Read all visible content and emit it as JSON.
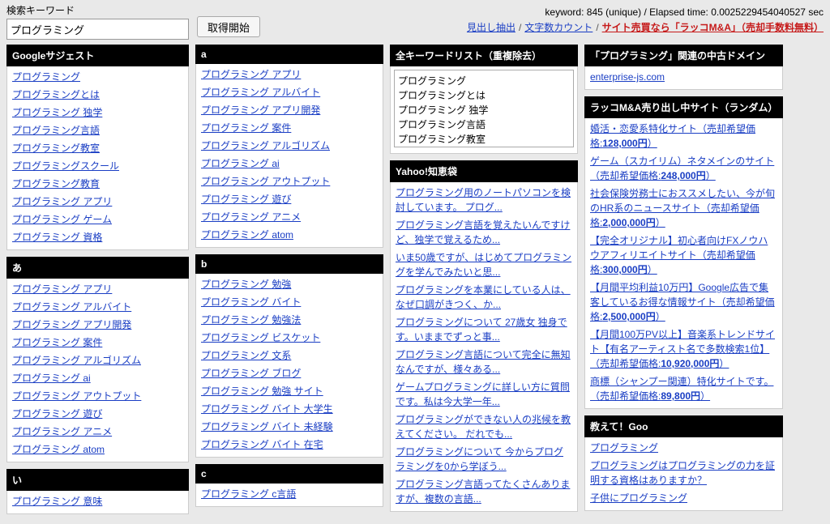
{
  "search": {
    "label": "検索キーワード",
    "value": "プログラミング",
    "button": "取得開始"
  },
  "meta": {
    "stats": "keyword: 845 (unique) / Elapsed time: 0.0025229454040527 sec",
    "nav": {
      "a": "見出し抽出",
      "b": "文字数カウント",
      "c": "サイト売買なら「ラッコM&A」（売却手数料無料）"
    }
  },
  "col1": {
    "google_suggest": {
      "title": "Googleサジェスト",
      "items": [
        "プログラミング",
        "プログラミングとは",
        "プログラミング 独学",
        "プログラミング言語",
        "プログラミング教室",
        "プログラミングスクール",
        "プログラミング教育",
        "プログラミング アプリ",
        "プログラミング ゲーム",
        "プログラミング 資格"
      ]
    },
    "a": {
      "title": "あ",
      "items": [
        "プログラミング アプリ",
        "プログラミング アルバイト",
        "プログラミング アプリ開発",
        "プログラミング 案件",
        "プログラミング アルゴリズム",
        "プログラミング ai",
        "プログラミング アウトプット",
        "プログラミング 遊び",
        "プログラミング アニメ",
        "プログラミング atom"
      ]
    },
    "i": {
      "title": "い",
      "items": [
        "プログラミング 意味"
      ]
    }
  },
  "col2": {
    "a": {
      "title": "a",
      "items": [
        "プログラミング アプリ",
        "プログラミング アルバイト",
        "プログラミング アプリ開発",
        "プログラミング 案件",
        "プログラミング アルゴリズム",
        "プログラミング ai",
        "プログラミング アウトプット",
        "プログラミング 遊び",
        "プログラミング アニメ",
        "プログラミング atom"
      ]
    },
    "b": {
      "title": "b",
      "items": [
        "プログラミング 勉強",
        "プログラミング バイト",
        "プログラミング 勉強法",
        "プログラミング ビスケット",
        "プログラミング 文系",
        "プログラミング ブログ",
        "プログラミング 勉強 サイト",
        "プログラミング バイト 大学生",
        "プログラミング バイト 未経験",
        "プログラミング バイト 在宅"
      ]
    },
    "c": {
      "title": "c",
      "items": [
        "プログラミング c言語"
      ]
    }
  },
  "col3": {
    "all_kw": {
      "title": "全キーワードリスト（重複除去）",
      "text": "プログラミング\nプログラミングとは\nプログラミング 独学\nプログラミング言語\nプログラミング教室"
    },
    "yahoo": {
      "title": "Yahoo!知恵袋",
      "items": [
        "プログラミング用のノートパソコンを検討しています。 プログ...",
        "プログラミング言語を覚えたいんですけど、独学で覚えるため...",
        "いま50歳ですが、はじめてプログラミングを学んでみたいと思...",
        "プログラミングを本業にしている人は、なぜ口調がきつく、か...",
        "プログラミングについて 27歳女 独身です。いままでずっと事...",
        "プログラミング言語について完全に無知なんですが、様々ある...",
        "ゲームプログラミングに詳しい方に質問です。私は今大学一年...",
        "プログラミングができない人の兆候を教えてください。 だれでも...",
        "プログラミングについて 今からプログラミングを0から学ぼう...",
        "プログラミング言語ってたくさんありますが、複数の言語..."
      ]
    }
  },
  "col4": {
    "used_domain": {
      "title": "「プログラミング」関連の中古ドメイン",
      "items": [
        "enterprise-js.com"
      ]
    },
    "rakko": {
      "title": "ラッコM&A売り出し中サイト（ランダム）",
      "items": [
        {
          "pre": "婚活・恋愛系特化サイト（売却希望価格:",
          "bold": "128,000円",
          "post": "）"
        },
        {
          "pre": "ゲーム（スカイリム）ネタメインのサイト（売却希望価格:",
          "bold": "248,000円",
          "post": "）"
        },
        {
          "pre": "社会保険労務士におススメしたい、今が旬のHR系のニュースサイト（売却希望価格:",
          "bold": "2,000,000円",
          "post": "）"
        },
        {
          "pre": "【完全オリジナル】初心者向けFXノウハウアフィリエイトサイト（売却希望価格:",
          "bold": "300,000円",
          "post": "）"
        },
        {
          "pre": "【月間平均利益10万円】Google広告で集客しているお得な情報サイト（売却希望価格:",
          "bold": "2,500,000円",
          "post": "）"
        },
        {
          "pre": "【月間100万PV以上】音楽系トレンドサイト【有名アーティスト名で多数検索1位】（売却希望価格:",
          "bold": "10,920,000円",
          "post": "）"
        },
        {
          "pre": "商標（シャンプー関連）特化サイトです。（売却希望価格:",
          "bold": "89,800円",
          "post": "）"
        }
      ]
    },
    "goo": {
      "title": "教えて！Goo",
      "items": [
        "プログラミング",
        "プログラミングはプログラミングの力を証明する資格はありますか？",
        "子供にプログラミング"
      ]
    }
  }
}
